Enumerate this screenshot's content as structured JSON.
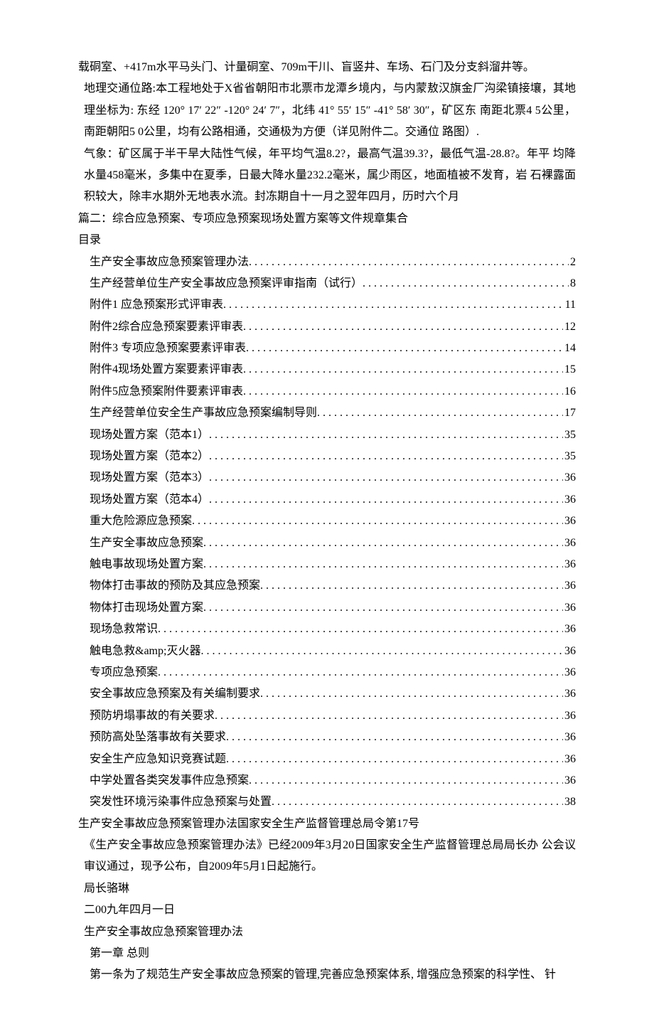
{
  "paragraphs": {
    "p1": "载硐室、+417m水平马头门、计量硐室、709m干川、盲竖井、车场、石门及分支斜溜井等。",
    "p2": "地理交通位路:本工程地处于X省省朝阳市北票市龙潭乡境内，与内蒙敖汉旗金厂沟梁镇接壤，其地理坐标为: 东经 120° 17′ 22″ -120° 24′ 7″，北纬 41° 55′ 15″ -41° 58′ 30″，矿区东 南距北票4 5公里，南距朝阳5 0公里，均有公路相通，交通极为方便（详见附件二。交通位 路图）.",
    "p3": "气象：矿区属于半干旱大陆性气候，年平均气温8.2?，最高气温39.3?，最低气温-28.8?。年平 均降水量458毫米，多集中在夏季，日最大降水量232.2毫米，属少雨区，地面植被不发育，岩 石裸露面积较大，除丰水期外无地表水流。封冻期自十一月之翌年四月，历时六个月"
  },
  "section2_title": "篇二：综合应急预案、专项应急预案现场处置方案等文件规章集合",
  "toc_label": "目录",
  "toc": [
    {
      "title": "生产安全事故应急预案管理办法",
      "page": "2"
    },
    {
      "title": "生产经营单位生产安全事故应急预案评审指南（试行）",
      "page": "8"
    },
    {
      "title": "附件1 应急预案形式评审表",
      "page": "11"
    },
    {
      "title": "附件2综合应急预案要素评审表",
      "page": "12"
    },
    {
      "title": "附件3 专项应急预案要素评审表",
      "page": "14"
    },
    {
      "title": "附件4现场处置方案要素评审表",
      "page": "15"
    },
    {
      "title": "附件5应急预案附件要素评审表",
      "page": "16"
    },
    {
      "title": "生产经营单位安全生产事故应急预案编制导则",
      "page": "17"
    },
    {
      "title": "现场处置方案（范本1）",
      "page": "35"
    },
    {
      "title": "现场处置方案（范本2）",
      "page": "35"
    },
    {
      "title": "现场处置方案（范本3）",
      "page": "36"
    },
    {
      "title": "现场处置方案（范本4）",
      "page": "36"
    },
    {
      "title": "重大危险源应急预案",
      "page": "36"
    },
    {
      "title": "生产安全事故应急预案",
      "page": "36"
    },
    {
      "title": "触电事故现场处置方案",
      "page": "36"
    },
    {
      "title": "物体打击事故的预防及其应急预案",
      "page": "36"
    },
    {
      "title": "物体打击现场处置方案",
      "page": "36"
    },
    {
      "title": "现场急救常识",
      "page": "36"
    },
    {
      "title": "触电急救&amp;灭火器",
      "page": "36"
    },
    {
      "title": "专项应急预案",
      "page": "36"
    },
    {
      "title": "安全事故应急预案及有关编制要求",
      "page": "36"
    },
    {
      "title": "预防坍塌事故的有关要求",
      "page": "36"
    },
    {
      "title": "预防高处坠落事故有关要求",
      "page": "36"
    },
    {
      "title": "安全生产应急知识竞赛试题",
      "page": "36"
    },
    {
      "title": "中学处置各类突发事件应急预案",
      "page": "36"
    },
    {
      "title": "突发性环境污染事件应急预案与处置",
      "page": "38"
    }
  ],
  "after_toc": {
    "line1": "生产安全事故应急预案管理办法国家安全生产监督管理总局令第17号",
    "line2": "《生产安全事故应急预案管理办法》已经2009年3月20日国家安全生产监督管理总局局长办 公会议审议通过，现予公布，自2009年5月1日起施行。",
    "line3": "局长骆琳",
    "line4": "二00九年四月一日",
    "line5": "生产安全事故应急预案管理办法",
    "line6": "第一章 总则",
    "line7": "第一条为了规范生产安全事故应急预案的管理,完善应急预案体系, 增强应急预案的科学性、 针"
  }
}
